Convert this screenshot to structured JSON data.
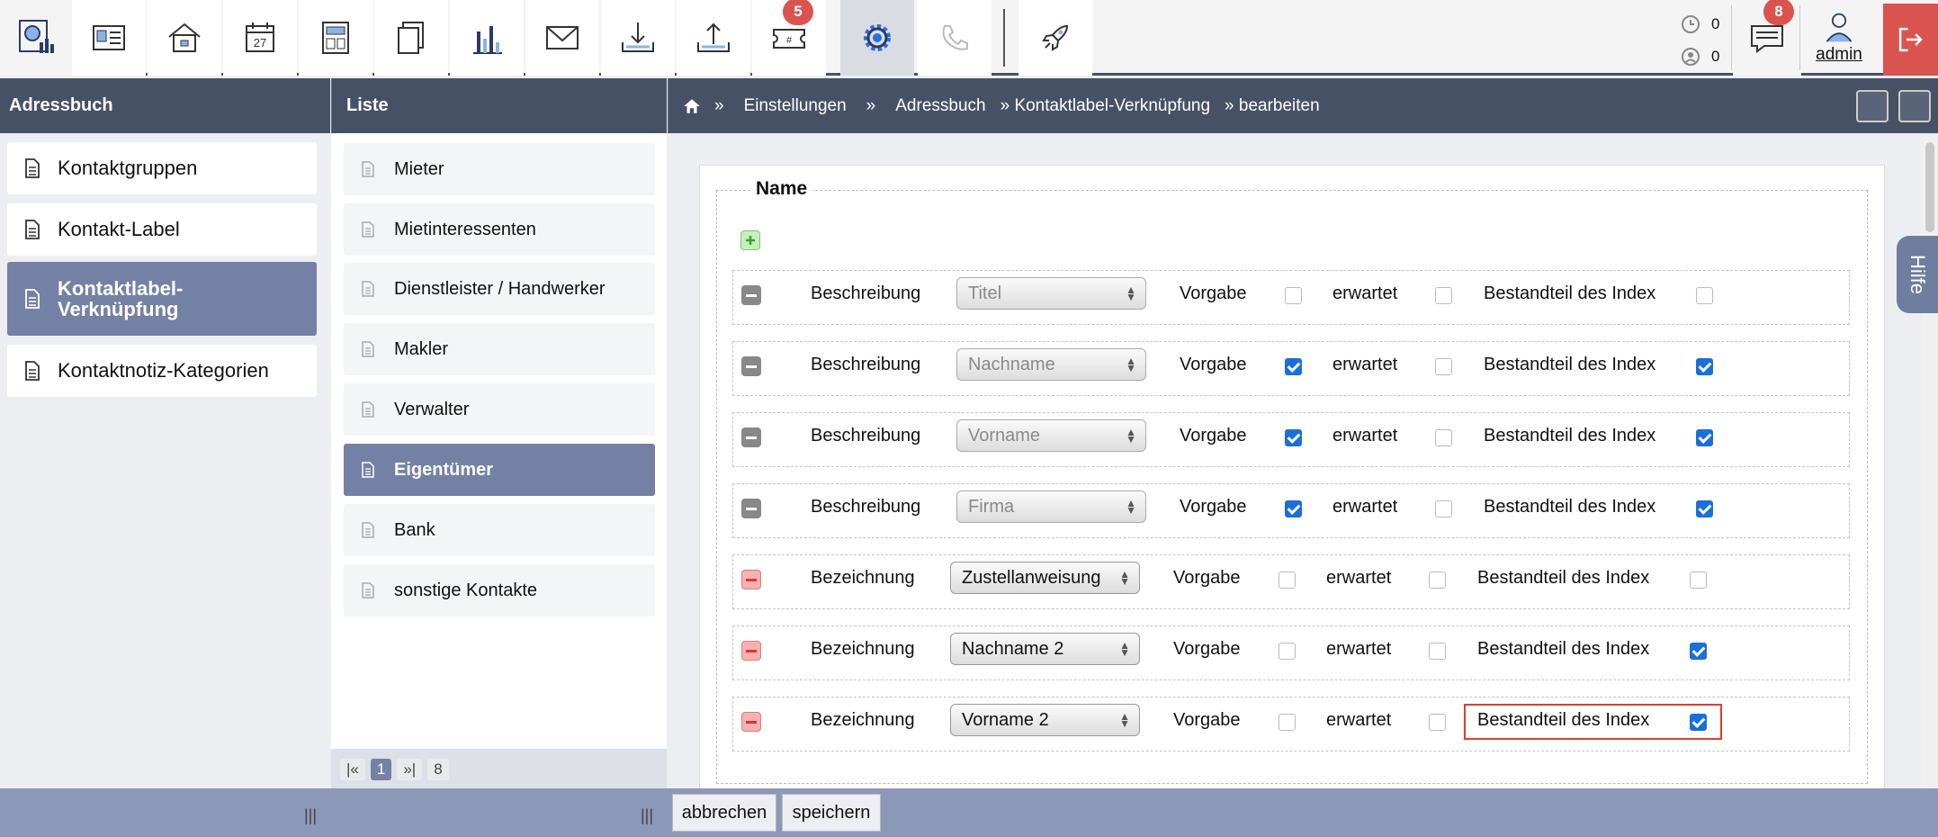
{
  "toolbar": {
    "icons": [
      "dashboard-icon",
      "contact-card-icon",
      "house-icon",
      "calendar-icon",
      "layout-icon",
      "documents-icon",
      "chart-icon",
      "mail-icon",
      "download-icon",
      "upload-icon",
      "ticket-icon",
      "gear-icon",
      "phone-icon",
      "rocket-icon"
    ],
    "calendar_day": "27",
    "ticket_badge": "5",
    "messages_badge": "8",
    "counter1": "0",
    "counter2": "0",
    "user": "admin"
  },
  "col1": {
    "header": "Adressbuch",
    "items": [
      "Kontaktgruppen",
      "Kontakt-Label",
      "Kontaktlabel-\nVerknüpfung",
      "Kontaktnotiz-Kategorien"
    ]
  },
  "col2": {
    "header": "Liste",
    "items": [
      "Mieter",
      "Mietinteressenten",
      "Dienstleister / Handwerker",
      "Makler",
      "Verwalter",
      "Eigentümer",
      "Bank",
      "sonstige Kontakte"
    ],
    "pager": {
      "first": "|«",
      "page": "1",
      "last": "»|",
      "total": "8"
    }
  },
  "breadcrumb": {
    "sep": "»",
    "items": [
      "Einstellungen",
      "Adressbuch",
      "» Kontaktlabel-Verknüpfung",
      "» bearbeiten"
    ]
  },
  "form": {
    "legend": "Name",
    "label_vorgabe": "Vorgabe",
    "label_erwartet": "erwartet",
    "label_index": "Bestandteil des Index",
    "rows": [
      {
        "label": "Beschreibung",
        "value": "Titel",
        "disabled": true,
        "vorgabe": false,
        "erwartet": false,
        "index": false
      },
      {
        "label": "Beschreibung",
        "value": "Nachname",
        "disabled": true,
        "vorgabe": true,
        "erwartet": false,
        "index": true
      },
      {
        "label": "Beschreibung",
        "value": "Vorname",
        "disabled": true,
        "vorgabe": true,
        "erwartet": false,
        "index": true
      },
      {
        "label": "Beschreibung",
        "value": "Firma",
        "disabled": true,
        "vorgabe": true,
        "erwartet": false,
        "index": true
      },
      {
        "label": "Bezeichnung",
        "value": "Zustellanweisung",
        "disabled": false,
        "vorgabe": false,
        "erwartet": false,
        "index": false
      },
      {
        "label": "Bezeichnung",
        "value": "Nachname 2",
        "disabled": false,
        "vorgabe": false,
        "erwartet": false,
        "index": true
      },
      {
        "label": "Bezeichnung",
        "value": "Vorname 2",
        "disabled": false,
        "vorgabe": false,
        "erwartet": false,
        "index": true
      }
    ]
  },
  "buttons": {
    "cancel": "abbrechen",
    "save": "speichern"
  },
  "help": "Hilfe",
  "colors": {
    "header": "#475166",
    "selected": "#7481a5",
    "danger": "#d9534f",
    "check": "#1b6fd8"
  }
}
